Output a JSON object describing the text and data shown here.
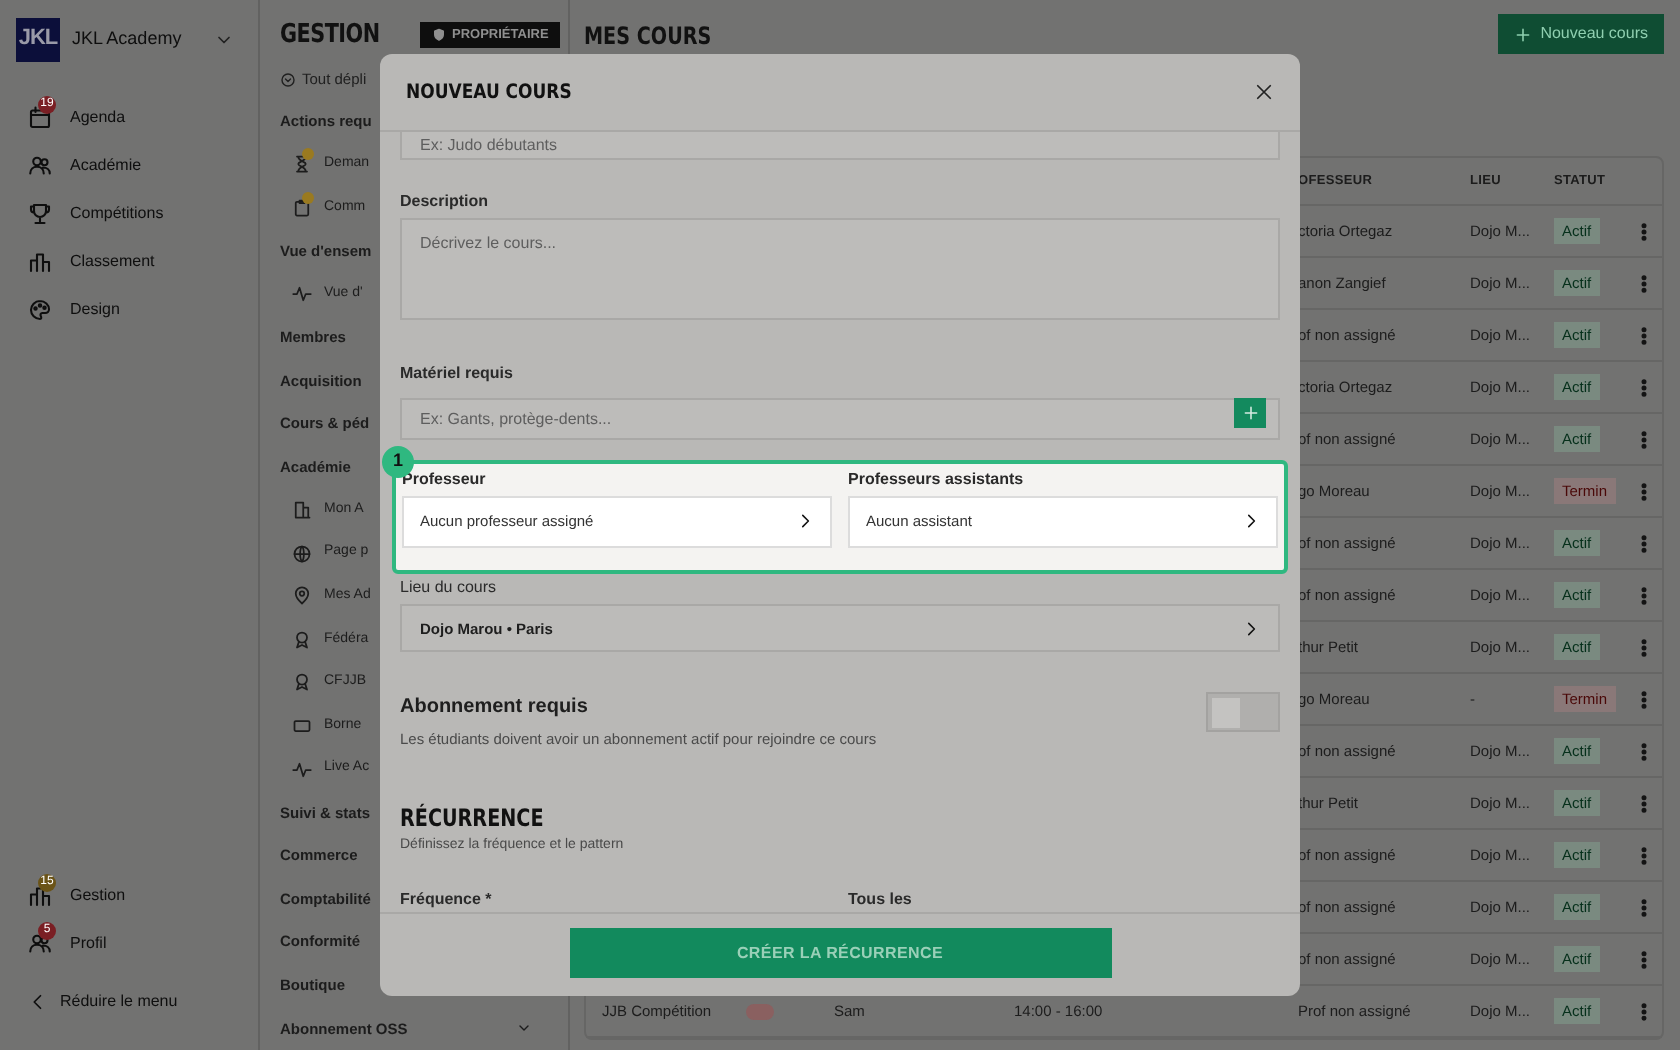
{
  "app_sidebar": {
    "logo": "JKL",
    "name": "JKL Academy",
    "items": [
      {
        "label": "Agenda",
        "badge": "19",
        "color": "#7a1f24"
      },
      {
        "label": "Académie"
      },
      {
        "label": "Compétitions"
      },
      {
        "label": "Classement"
      },
      {
        "label": "Design"
      }
    ],
    "bottom_items": [
      {
        "label": "Gestion",
        "badge": "15",
        "color": "#6b5418"
      },
      {
        "label": "Profil",
        "badge": "5",
        "color": "#7a1f24"
      }
    ],
    "collapse": "Réduire le menu"
  },
  "section_sidebar": {
    "title": "GESTION",
    "role": "PROPRIÉTAIRE",
    "expand_all": "Tout dépli",
    "groups": [
      {
        "label": "Actions requ",
        "children": [
          {
            "label": "Deman",
            "alert": true
          },
          {
            "label": "Comm",
            "alert": true
          }
        ]
      },
      {
        "label": "Vue d'ensem",
        "children": [
          {
            "label": "Vue d'",
            "alert": false
          }
        ]
      },
      {
        "label": "Membres"
      },
      {
        "label": "Acquisition"
      },
      {
        "label": "Cours & péd"
      },
      {
        "label": "Académie",
        "children": [
          {
            "label": "Mon A",
            "alert": false
          },
          {
            "label": "Page p",
            "alert": false
          },
          {
            "label": "Mes Ad",
            "alert": false
          },
          {
            "label": "Fédéra",
            "alert": false
          },
          {
            "label": "CFJJB",
            "alert": false
          },
          {
            "label": "Borne",
            "alert": false
          },
          {
            "label": "Live Ac",
            "alert": false
          }
        ]
      },
      {
        "label": "Suivi & stats"
      },
      {
        "label": "Commerce"
      },
      {
        "label": "Comptabilité"
      },
      {
        "label": "Conformité"
      },
      {
        "label": "Boutique"
      },
      {
        "label": "Abonnement OSS",
        "expandable": true
      }
    ]
  },
  "page": {
    "title": "MES COURS",
    "new_button": "Nouveau cours",
    "columns": [
      "OFESSEUR",
      "LIEU",
      "STATUT"
    ],
    "rows": [
      {
        "professor": "ctoria Ortegaz",
        "venue": "Dojo M...",
        "status": "Actif",
        "kind": "active"
      },
      {
        "professor": "anon Zangief",
        "venue": "Dojo M...",
        "status": "Actif",
        "kind": "active"
      },
      {
        "professor": "of non assigné",
        "venue": "Dojo M...",
        "status": "Actif",
        "kind": "active"
      },
      {
        "professor": "ctoria Ortegaz",
        "venue": "Dojo M...",
        "status": "Actif",
        "kind": "active"
      },
      {
        "professor": "of non assigné",
        "venue": "Dojo M...",
        "status": "Actif",
        "kind": "active"
      },
      {
        "professor": "go Moreau",
        "venue": "Dojo M...",
        "status": "Termin",
        "kind": "ended"
      },
      {
        "professor": "of non assigné",
        "venue": "Dojo M...",
        "status": "Actif",
        "kind": "active"
      },
      {
        "professor": "of non assigné",
        "venue": "Dojo M...",
        "status": "Actif",
        "kind": "active"
      },
      {
        "professor": "thur Petit",
        "venue": "Dojo M...",
        "status": "Actif",
        "kind": "active"
      },
      {
        "professor": "go Moreau",
        "venue": "-",
        "status": "Termin",
        "kind": "ended"
      },
      {
        "professor": "of non assigné",
        "venue": "Dojo M...",
        "status": "Actif",
        "kind": "active"
      },
      {
        "professor": "thur Petit",
        "venue": "Dojo M...",
        "status": "Actif",
        "kind": "active"
      },
      {
        "professor": "of non assigné",
        "venue": "Dojo M...",
        "status": "Actif",
        "kind": "active"
      },
      {
        "professor": "of non assigné",
        "venue": "Dojo M...",
        "status": "Actif",
        "kind": "active"
      },
      {
        "professor": "of non assigné",
        "venue": "Dojo M...",
        "status": "Actif",
        "kind": "active"
      },
      {
        "name": "JJB Compétition",
        "day": "Sam",
        "time": "14:00 - 16:00",
        "professor": "Prof non assigné",
        "venue": "Dojo M...",
        "status": "Actif",
        "kind": "active"
      }
    ]
  },
  "modal": {
    "title": "NOUVEAU COURS",
    "name_field": {
      "placeholder": "Ex: Judo débutants"
    },
    "description": {
      "label": "Description",
      "placeholder": "Décrivez le cours..."
    },
    "equipment": {
      "label": "Matériel requis",
      "placeholder": "Ex: Gants, protège-dents..."
    },
    "highlight": {
      "step": "1",
      "fields": [
        {
          "label": "Professeur",
          "value": "Aucun professeur assigné"
        },
        {
          "label": "Professeurs assistants",
          "value": "Aucun assistant"
        }
      ]
    },
    "venue": {
      "label": "Lieu du cours",
      "value": "Dojo Marou • Paris"
    },
    "subscription": {
      "title": "Abonnement requis",
      "description": "Les étudiants doivent avoir un abonnement actif pour rejoindre ce cours",
      "on": false
    },
    "recurrence": {
      "title": "RÉCURRENCE",
      "subtitle": "Définissez la fréquence et le pattern",
      "fields": [
        "Fréquence *",
        "Tous les"
      ]
    },
    "submit": "CRÉER LA RÉCURRENCE"
  }
}
